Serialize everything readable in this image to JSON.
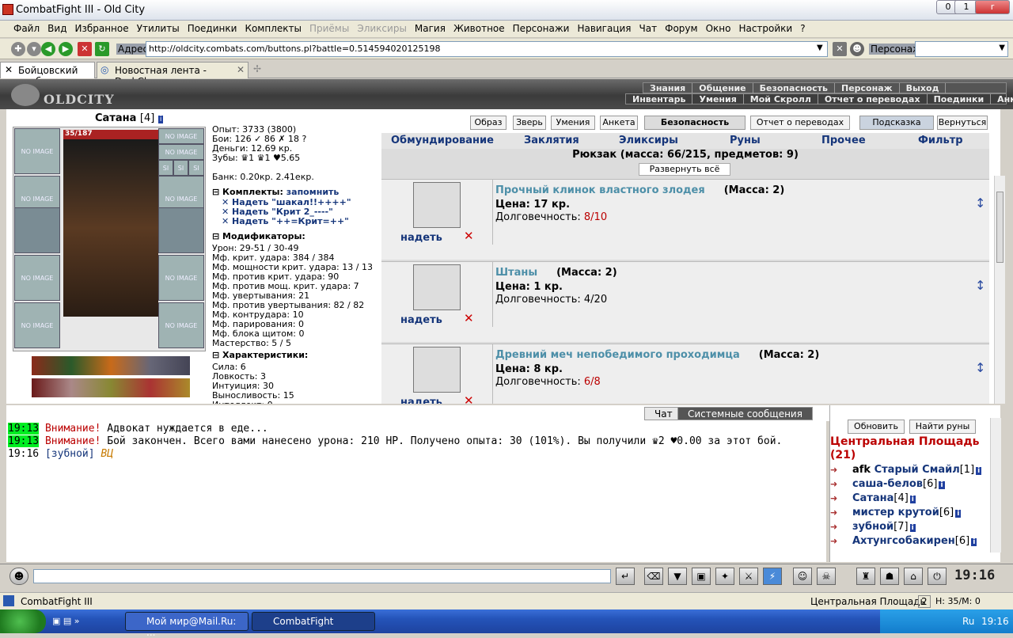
{
  "window": {
    "title": "CombatFight III - Old City",
    "minimize": "0",
    "maximize": "1",
    "close": "r"
  },
  "menu": [
    {
      "label": "Файл",
      "disabled": false
    },
    {
      "label": "Вид",
      "disabled": false
    },
    {
      "label": "Избранное",
      "disabled": false
    },
    {
      "label": "Утилиты",
      "disabled": false
    },
    {
      "label": "Поединки",
      "disabled": false
    },
    {
      "label": "Комплекты",
      "disabled": false
    },
    {
      "label": "Приёмы",
      "disabled": true
    },
    {
      "label": "Эликсиры",
      "disabled": true
    },
    {
      "label": "Магия",
      "disabled": false
    },
    {
      "label": "Животное",
      "disabled": false
    },
    {
      "label": "Персонажи",
      "disabled": false
    },
    {
      "label": "Навигация",
      "disabled": false
    },
    {
      "label": "Чат",
      "disabled": false
    },
    {
      "label": "Форум",
      "disabled": false
    },
    {
      "label": "Окно",
      "disabled": false
    },
    {
      "label": "Настройки",
      "disabled": false
    },
    {
      "label": "?",
      "disabled": false
    }
  ],
  "address": {
    "label": "Адрес:",
    "url": "http://oldcity.combats.com/buttons.pl?battle=0.514594020125198",
    "persona_label": "Персонаж:"
  },
  "tabs": [
    {
      "label": "Бойцовский клуб"
    },
    {
      "label": "Новостная лента - DarkClan"
    }
  ],
  "game_header": {
    "logo": "OLDCITY",
    "nav_top": [
      "Знания",
      "Общение",
      "Безопасность",
      "Персонаж",
      "Выход"
    ],
    "nav_bottom": [
      "Инвентарь",
      "Умения",
      "Мой Скролл",
      "Отчет о переводах",
      "Поединки",
      "Анкета"
    ]
  },
  "character": {
    "name": "Сатана",
    "level": "[4]",
    "hp": "35/187",
    "slot_text": "NO IMAGE",
    "slot_small": "SI",
    "stats": {
      "exp": "Опыт: 3733 (3800)",
      "fights": "Бои: 126 ✓ 86 ✗ 18 ?",
      "money": "Деньги: 12.69 кр.",
      "teeth": "Зубы: ♛1 ♛1 ♥5.65",
      "bank": "Банк: 0.20кр. 2.41екр."
    },
    "sets_header": "Комплекты:",
    "remember": "запомнить",
    "sets": [
      "Надеть \"шакал!!++++\"",
      "Надеть \"Крит 2_----\"",
      "Надеть \"++=Крит=++\""
    ],
    "mods_header": "Модификаторы:",
    "mods": [
      "Урон: 29-51 / 30-49",
      "Мф. крит. удара: 384 / 384",
      "Мф. мощности крит. удара: 13 / 13",
      "Мф. против крит. удара: 90",
      "Мф. против мощ. крит. удара: 7",
      "Мф. увертывания: 21",
      "Мф. против увертывания: 82 / 82",
      "Мф. контрудара: 10",
      "Мф. парирования: 0",
      "Мф. блока щитом: 0",
      "Мастерство: 5 / 5"
    ],
    "chars_header": "Характеристики:",
    "chars": [
      "Сила: 6",
      "Ловкость: 3",
      "Интуиция: 30",
      "Выносливость: 15",
      "Интеллект: 0"
    ]
  },
  "top_buttons": [
    "Образ",
    "Зверь",
    "Умения",
    "Анкета",
    "Безопасность",
    "Отчет о переводах",
    "Подсказка",
    "Вернуться"
  ],
  "inventory_tabs": [
    "Обмундирование",
    "Заклятия",
    "Эликсиры",
    "Руны",
    "Прочее",
    "Фильтр"
  ],
  "rucksack": {
    "title": "Рюкзак (масса: 66/215, предметов: 9)",
    "expand": "Развернуть всё"
  },
  "items": [
    {
      "name": "Прочный клинок властного злодея",
      "mass": "(Масса: 2)",
      "price": "Цена: 17 кр.",
      "dur_label": "Долговечность:",
      "dur": "8/10",
      "dur_red": true,
      "wear": "надеть"
    },
    {
      "name": "Штаны",
      "mass": "(Масса: 2)",
      "price": "Цена: 1 кр.",
      "dur_label": "Долговечность:",
      "dur": "4/20",
      "dur_red": false,
      "wear": "надеть"
    },
    {
      "name": "Древний меч непобедимого проходимца",
      "mass": "(Масса: 2)",
      "price": "Цена: 8 кр.",
      "dur_label": "Долговечность:",
      "dur": "6/8",
      "dur_red": true,
      "wear": "надеть"
    }
  ],
  "chat_tabs": [
    "Чат",
    "Системные сообщения"
  ],
  "chat": {
    "l1_time": "19:13",
    "l1_warn": "Внимание!",
    "l1_text": " Адвокат нуждается в еде...",
    "l2_time": "19:13",
    "l2_warn": "Внимание!",
    "l2_text": " Бой закончен. Всего вами нанесено урона: 210 HP. Получено опыта: 30 (101%). Вы получили ♛2 ♥0.00 за этот бой.",
    "l3_time": "19:16",
    "l3_user": "[зубной]",
    "l3_text": " ВЦ"
  },
  "side": {
    "refresh": "Обновить",
    "find_runes": "Найти руны",
    "location": "Центральная Площадь (21)",
    "players": [
      {
        "prefix": "afk ",
        "name": "Старый Смайл",
        "level": "[1]"
      },
      {
        "prefix": "",
        "name": "саша-белов",
        "level": "[6]"
      },
      {
        "prefix": "",
        "name": "Сатана",
        "level": "[4]"
      },
      {
        "prefix": "",
        "name": "мистер крутой",
        "level": "[6]"
      },
      {
        "prefix": "",
        "name": "зубной",
        "level": "[7]"
      },
      {
        "prefix": "",
        "name": "Ахтунгсобакирен",
        "level": "[6]"
      }
    ]
  },
  "clock": "19:16",
  "status": {
    "app": "CombatFight III",
    "location": "Центральная Площадь",
    "counter": "2",
    "hp": "H: 35/M: 0"
  },
  "taskbar": {
    "tasks": [
      "Мой мир@Mail.Ru: ...",
      "CombatFight"
    ],
    "lang": "Ru",
    "time": "19:16"
  },
  "colors": {
    "accent_blue": "#15357a",
    "warn_red": "#bb0000",
    "timestamp_green": "#00ee22",
    "item_name": "#4d8fa8"
  }
}
